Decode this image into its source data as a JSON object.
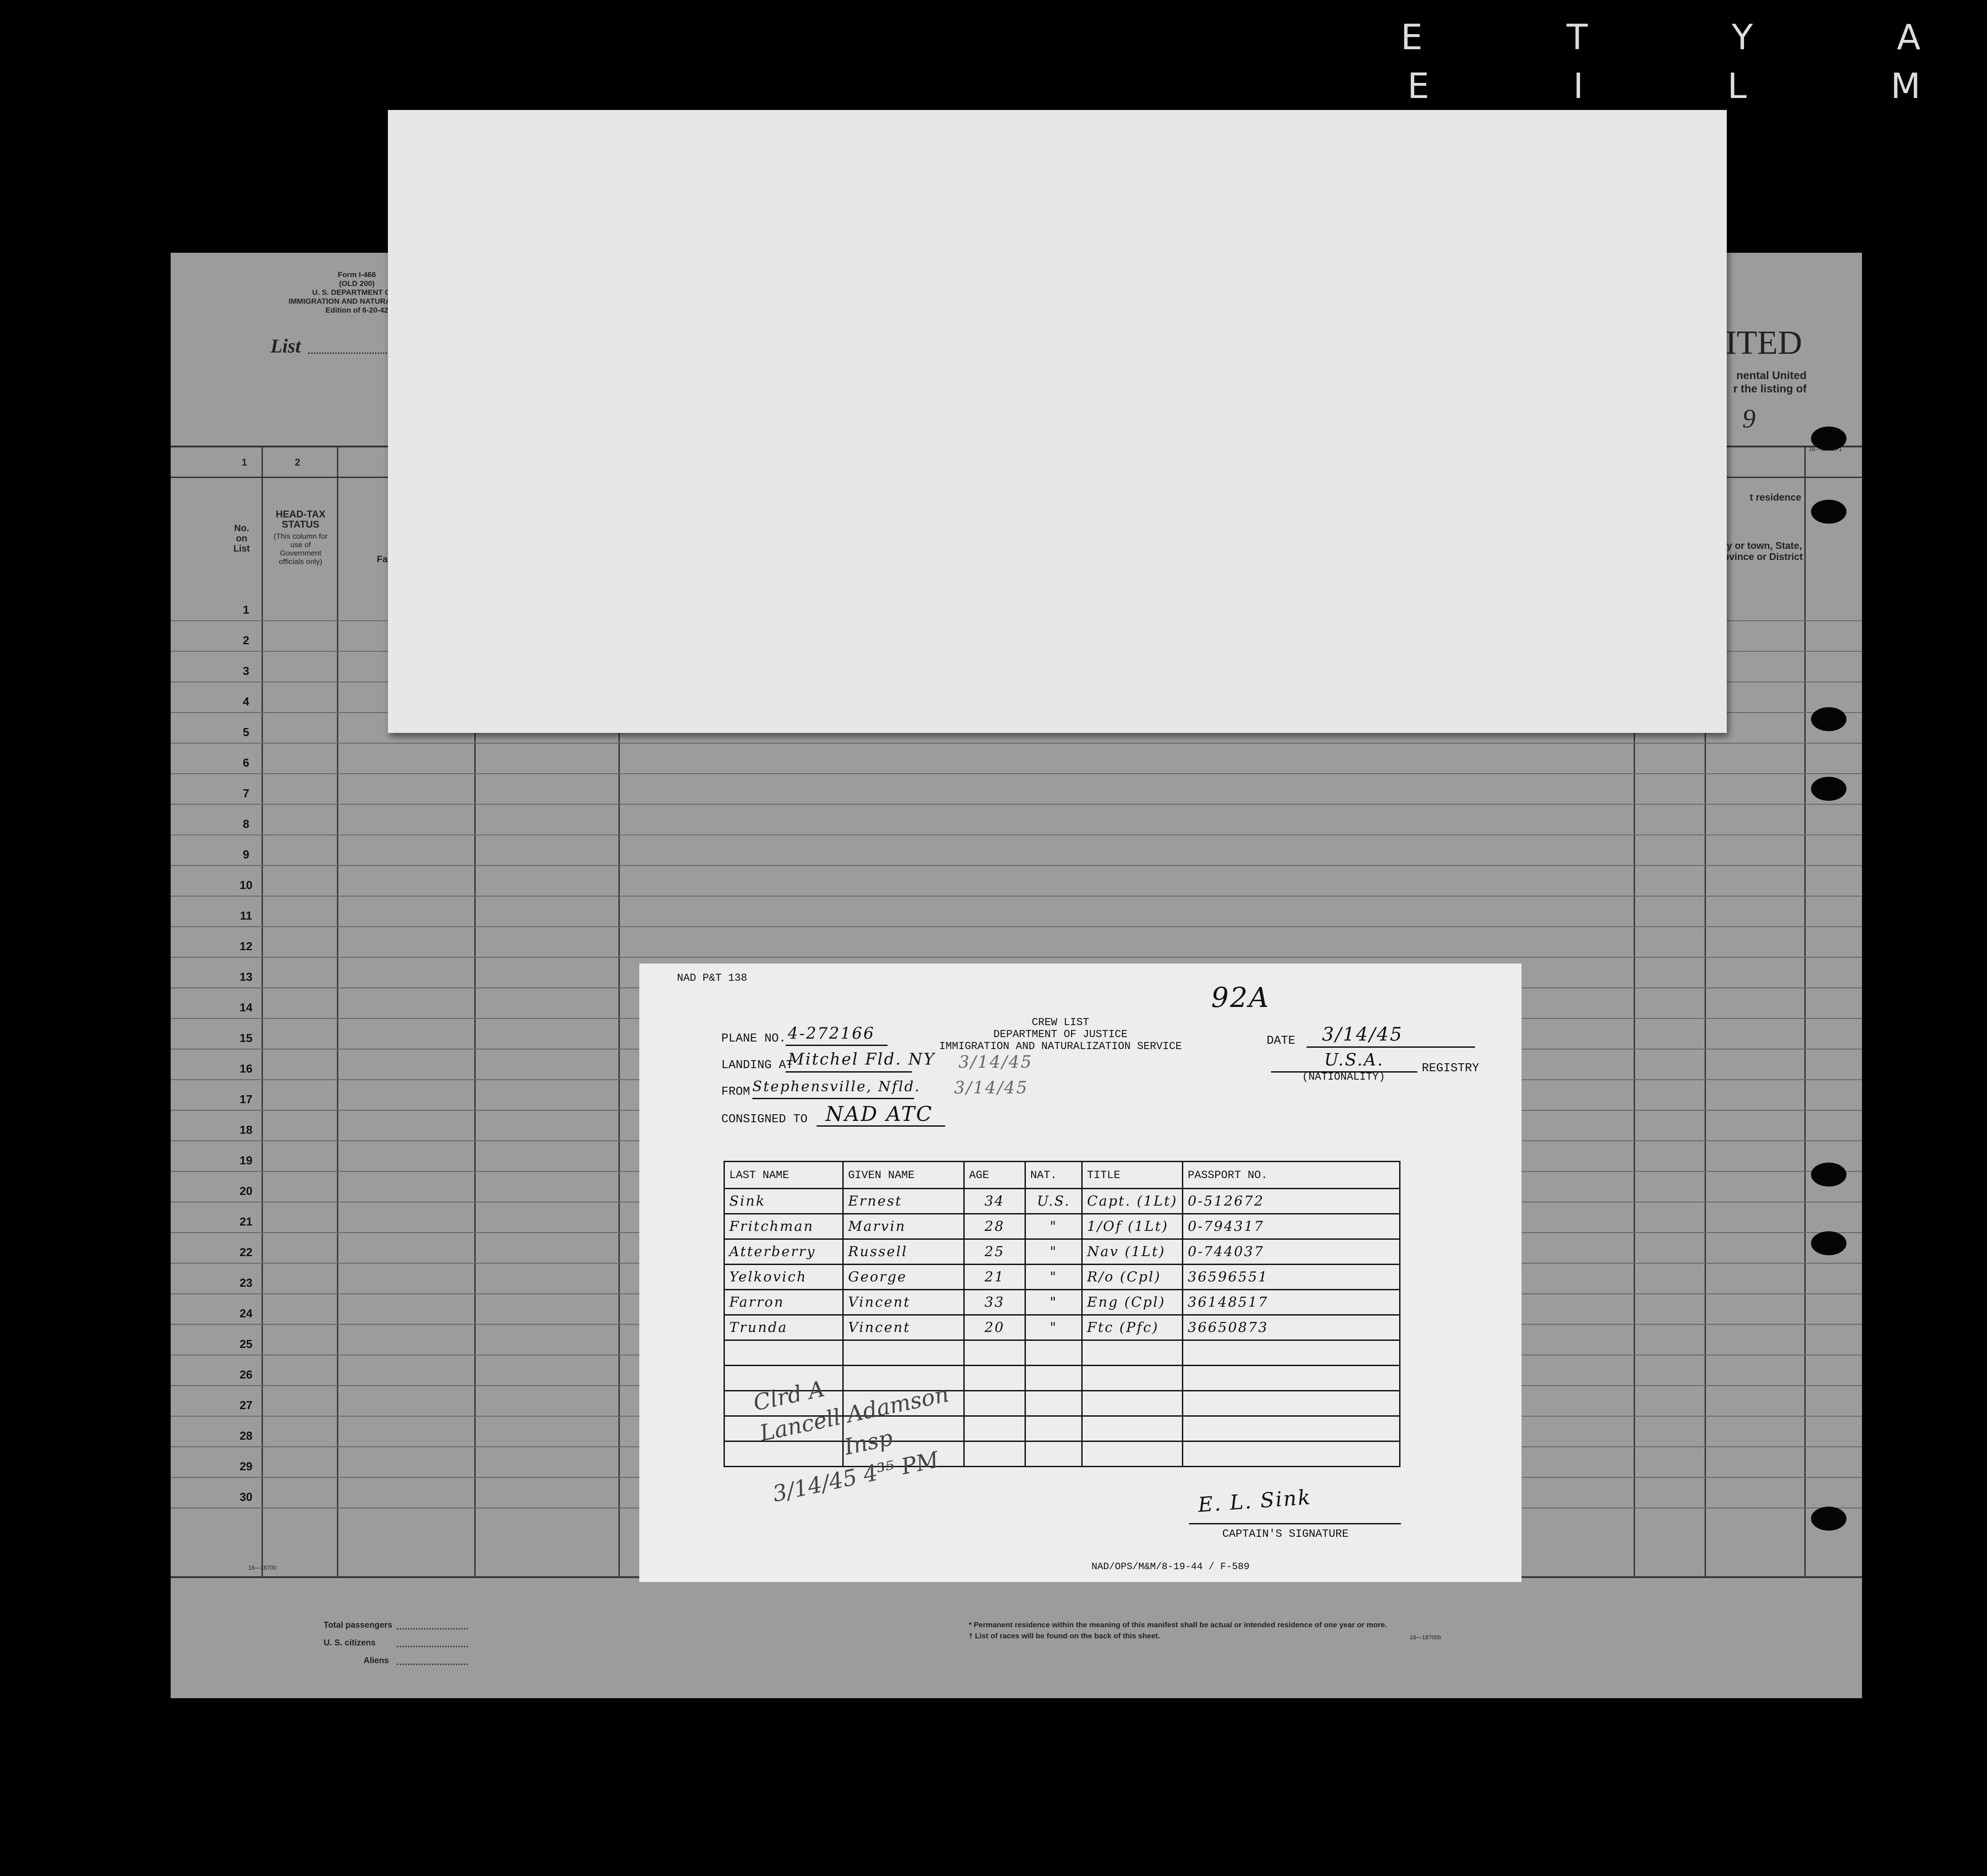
{
  "film_strip": {
    "text": "E T Y A E I L M"
  },
  "manifest_form": {
    "header_left_lines": [
      "Form I-466",
      "(OLD 200)",
      "U. S. DEPARTMENT OF J",
      "IMMIGRATION AND NATURALIZATION",
      "Edition of 6-20-42"
    ],
    "list_label": "List",
    "title_fragment": "ITED",
    "header_right_lines": [
      "nental United",
      "r the listing of"
    ],
    "year_fragment": "9",
    "header_code": "16—18700-1",
    "col_1_num": "1",
    "col_2_num": "2",
    "col_1_head": "No. on List",
    "col_2_head": "HEAD-TAX STATUS",
    "col_2_sub": "(This column for use of Government officials only)",
    "col_3_frag": "Fa",
    "right_head_1": "t residence",
    "right_head_2": "City or town, State, Province or District",
    "row_numbers": [
      "1",
      "2",
      "3",
      "4",
      "5",
      "6",
      "7",
      "8",
      "9",
      "10",
      "11",
      "12",
      "13",
      "14",
      "15",
      "16",
      "17",
      "18",
      "19",
      "20",
      "21",
      "22",
      "23",
      "24",
      "25",
      "26",
      "27",
      "28",
      "29",
      "30"
    ],
    "footer_code": "16—18700",
    "total_passengers": "Total passengers",
    "us_citizens": "U. S. citizens",
    "aliens": "Aliens",
    "footnote_1": "* Permanent residence within the meaning of this manifest shall be actual or intended residence of one year or more.",
    "footnote_2": "† List of races will be found on the back of this sheet.",
    "footnote_code": "16—18700b"
  },
  "crew_card": {
    "form_code": "NAD P&T 138",
    "page_no": "92A",
    "header_1": "CREW LIST",
    "header_2": "DEPARTMENT OF JUSTICE",
    "header_3": "IMMIGRATION AND NATURALIZATION SERVICE",
    "plane_label": "PLANE NO.",
    "plane_no": "4-272166",
    "landing_label": "LANDING AT",
    "landing_at": "Mitchel Fld. NY",
    "landing_date": "3/14/45",
    "from_label": "FROM",
    "from": "Stephensville, Nfld.",
    "from_date": "3/14/45",
    "consigned_label": "CONSIGNED TO",
    "consigned_to": "NAD ATC",
    "date_label": "DATE",
    "date": "3/14/45",
    "nationality": "U.S.A.",
    "registry_label": "REGISTRY",
    "nationality_label": "(NATIONALITY)",
    "columns": [
      "LAST NAME",
      "GIVEN NAME",
      "AGE",
      "NAT.",
      "TITLE",
      "PASSPORT NO."
    ],
    "crew": [
      {
        "last": "Sink",
        "given": "Ernest",
        "age": "34",
        "nat": "U.S.",
        "title": "Capt. (1Lt)",
        "passport": "0-512672"
      },
      {
        "last": "Fritchman",
        "given": "Marvin",
        "age": "28",
        "nat": "\"",
        "title": "1/Of (1Lt)",
        "passport": "0-794317"
      },
      {
        "last": "Atterberry",
        "given": "Russell",
        "age": "25",
        "nat": "\"",
        "title": "Nav (1Lt)",
        "passport": "0-744037"
      },
      {
        "last": "Yelkovich",
        "given": "George",
        "age": "21",
        "nat": "\"",
        "title": "R/o (Cpl)",
        "passport": "36596551"
      },
      {
        "last": "Farron",
        "given": "Vincent",
        "age": "33",
        "nat": "\"",
        "title": "Eng (Cpl)",
        "passport": "36148517"
      },
      {
        "last": "Trunda",
        "given": "Vincent",
        "age": "20",
        "nat": "\"",
        "title": "Ftc (Pfc)",
        "passport": "36650873"
      }
    ],
    "stamp_lines": [
      "Clrd A",
      "Lancell Adamson",
      "Insp",
      "3/14/45  4³⁵ PM"
    ],
    "captain_signature": "E. L. Sink",
    "captain_label": "CAPTAIN'S SIGNATURE",
    "footer_code": "NAD/OPS/M&M/8-19-44 / F-589"
  }
}
